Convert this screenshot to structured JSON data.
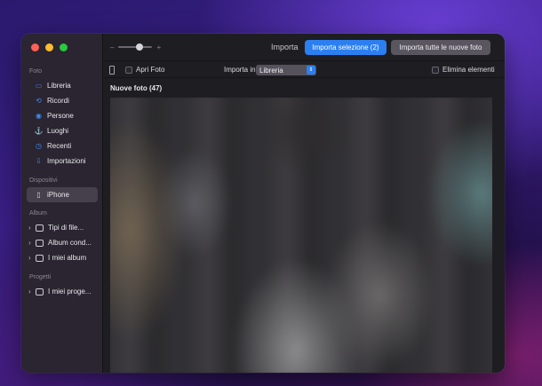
{
  "window": {
    "traffic_lights": {
      "close_color": "#ff5f57",
      "minimize_color": "#febc2e",
      "zoom_color": "#28c840"
    }
  },
  "sidebar": {
    "sections": [
      {
        "header": "Foto",
        "items": [
          {
            "label": "Libreria",
            "icon": "photo-library-icon"
          },
          {
            "label": "Ricordi",
            "icon": "memories-icon"
          },
          {
            "label": "Persone",
            "icon": "people-icon"
          },
          {
            "label": "Luoghi",
            "icon": "places-icon"
          },
          {
            "label": "Recenti",
            "icon": "recents-icon"
          },
          {
            "label": "Importazioni",
            "icon": "imports-icon"
          }
        ]
      },
      {
        "header": "Dispositivi",
        "items": [
          {
            "label": "iPhone",
            "icon": "iphone-icon",
            "selected": true
          }
        ]
      },
      {
        "header": "Album",
        "items": [
          {
            "label": "Tipi di file...",
            "icon": "folder-icon"
          },
          {
            "label": "Album cond...",
            "icon": "shared-folder-icon"
          },
          {
            "label": "I miei album",
            "icon": "folder-icon"
          }
        ]
      },
      {
        "header": "Progetti",
        "items": [
          {
            "label": "I miei proge...",
            "icon": "folder-icon"
          }
        ]
      }
    ]
  },
  "toolbar": {
    "zoom_minus": "–",
    "zoom_plus": "+",
    "title": "Importa",
    "import_selection_label": "Importa selezione (2)",
    "import_all_label": "Importa tutte le nuove foto",
    "accent_color": "#2c7ff0"
  },
  "options": {
    "open_photos_label": "Apri Foto",
    "import_in_label": "Importa in:",
    "import_in_value": "Libreria",
    "delete_items_label": "Elimina elementi"
  },
  "content": {
    "section_title": "Nuove foto (47)"
  }
}
